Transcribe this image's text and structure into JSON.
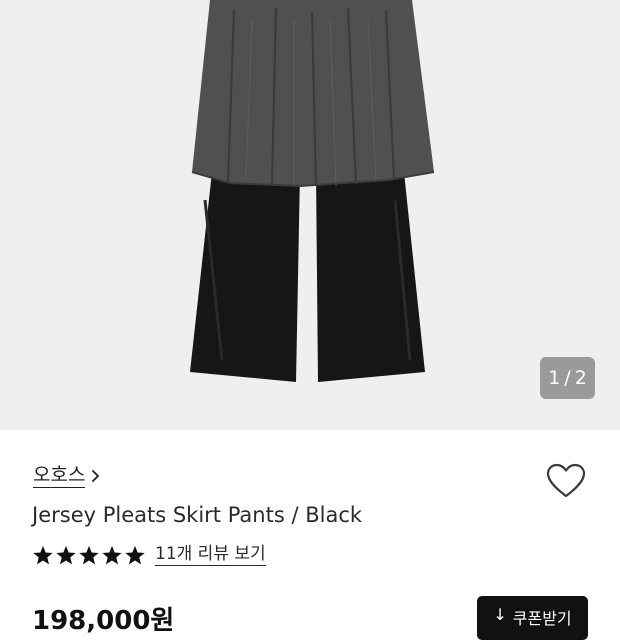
{
  "gallery": {
    "current_page": "1",
    "separator": "/",
    "total_pages": "2"
  },
  "product": {
    "brand": "오호스",
    "name": "Jersey Pleats Skirt Pants / Black",
    "rating_stars": 5,
    "review_link": "11개 리뷰 보기",
    "price": "198,000원",
    "coupon_button": "쿠폰받기",
    "coupon_icon": "↓"
  },
  "icons": {
    "brand_chevron": "chevron-right-icon",
    "wishlist": "heart-icon",
    "star": "star-icon",
    "coupon": "download-arrow-icon"
  },
  "colors": {
    "star": "#111111",
    "button_bg": "#111111",
    "hero_bg": "#efefef",
    "pager_bg": "#9a9a9a"
  }
}
